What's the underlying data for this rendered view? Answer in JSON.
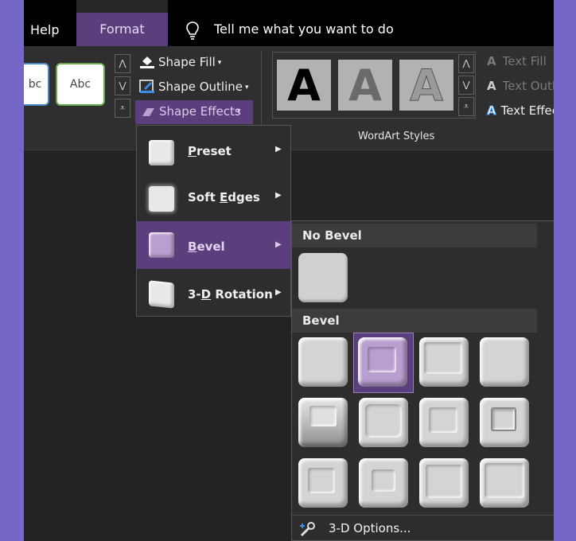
{
  "tabs": {
    "help": "Help",
    "format": "Format"
  },
  "tell_me": {
    "text": "Tell me what you want to do"
  },
  "ribbon": {
    "style_previews": [
      "bc",
      "Abc"
    ],
    "shape_fill": "Shape Fill",
    "shape_outline": "Shape Outline",
    "shape_effects": "Shape Effects",
    "wordart_letter": "A",
    "wordart_label": "WordArt Styles",
    "text_fill": "Text Fill",
    "text_outline": "Text Outl",
    "text_effects": "Text Effec"
  },
  "menu": {
    "items": [
      {
        "label": "Preset",
        "accel": "P",
        "rest": "reset"
      },
      {
        "label": "Soft Edges",
        "pre": "Soft ",
        "accel": "E",
        "rest": "dges"
      },
      {
        "label": "Bevel",
        "accel": "B",
        "rest": "evel"
      },
      {
        "label": "3-D Rotation",
        "pre": "3-",
        "accel": "D",
        "rest": " Rotation"
      }
    ]
  },
  "bevel_panel": {
    "no_bevel_header": "No Bevel",
    "bevel_header": "Bevel",
    "options_label": "3-D Options..."
  },
  "colors": {
    "accent": "#5b3f7d",
    "accent_light": "#b89fd0",
    "background_frame": "#7467c8"
  }
}
